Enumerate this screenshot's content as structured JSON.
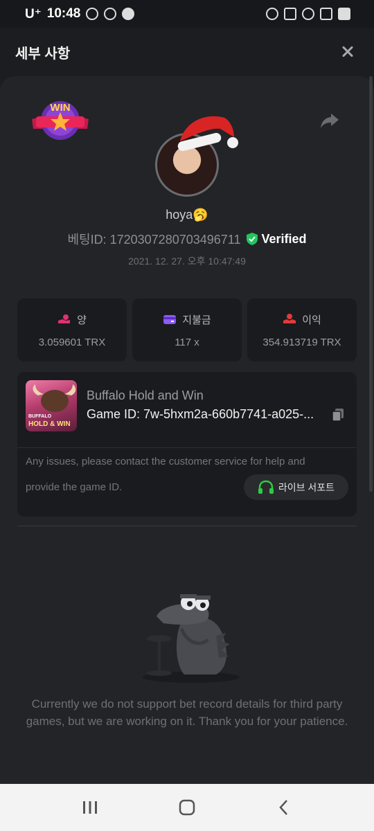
{
  "status_bar": {
    "carrier": "U⁺",
    "time": "10:48"
  },
  "header": {
    "title": "세부 사항"
  },
  "profile": {
    "badge": "WIN",
    "username": "hoya🥱",
    "bet_id": "베팅ID: 1720307280703496711",
    "verified": "Verified",
    "datetime": "2021. 12. 27. 오후 10:47:49"
  },
  "stats": [
    {
      "label": "양",
      "value": "3.059601 TRX",
      "icon": "coin-hand-icon"
    },
    {
      "label": "지불금",
      "value": "117 x",
      "icon": "wallet-icon"
    },
    {
      "label": "이익",
      "value": "354.913719 TRX",
      "icon": "profit-hand-icon"
    }
  ],
  "game": {
    "name": "Buffalo Hold and Win",
    "id": "Game ID: 7w-5hxm2a-660b7741-a025-...",
    "thumb_line1": "BUFFALO",
    "thumb_line2": "HOLD & WIN",
    "help_line1": "Any issues, please contact the customer service for help and",
    "help_line2": "provide the game ID.",
    "support_label": "라이브 서포트"
  },
  "empty_state": {
    "message": "Currently we do not support bet record details for third party games, but we are working on it. Thank you for your patience."
  },
  "colors": {
    "accent_pink": "#e0336b",
    "accent_purple": "#8b5cf6",
    "accent_red": "#e23b3b",
    "verified_green": "#22c55e",
    "support_green": "#2ecc40"
  }
}
